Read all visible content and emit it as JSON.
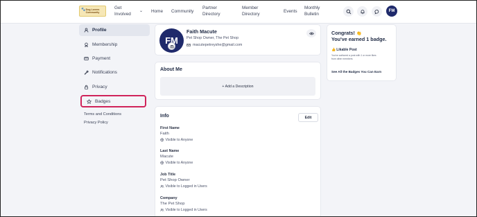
{
  "logo": {
    "line1": "Dog Lovers",
    "line2": "Community"
  },
  "nav": {
    "items": [
      {
        "label": "Get Involved",
        "line1": "Get",
        "line2": "Involved"
      },
      {
        "label": "Home"
      },
      {
        "label": "Community"
      },
      {
        "label": "Partner Directory",
        "line1": "Partner",
        "line2": "Directory"
      },
      {
        "label": "Member Directory",
        "line1": "Member",
        "line2": "Directory"
      },
      {
        "label": "Events"
      },
      {
        "label": "Monthly Bulletin",
        "line1": "Monthly",
        "line2": "Bulletin"
      }
    ],
    "icons": [
      "search-icon",
      "bell-icon",
      "chat-icon"
    ],
    "avatar_initials": "FM"
  },
  "sidebar": {
    "items": [
      {
        "label": "Profile",
        "icon": "user-icon",
        "active": true
      },
      {
        "label": "Membership",
        "icon": "badge-icon"
      },
      {
        "label": "Payment",
        "icon": "card-icon"
      },
      {
        "label": "Notifications",
        "icon": "wrench-icon"
      },
      {
        "label": "Privacy",
        "icon": "lock-icon"
      },
      {
        "label": "Badges",
        "icon": "star-icon",
        "highlighted": true
      }
    ],
    "links": [
      "Terms and Conditions",
      "Privacy Policy"
    ]
  },
  "profile": {
    "initials": "FM",
    "name": "Faith Macute",
    "subtitle": "Pet Shop Owner, The Pet Shop",
    "email": "macutepetreyshe@gmail.com"
  },
  "about": {
    "title": "About Me",
    "add_label": "+ Add a Description"
  },
  "info": {
    "title": "Info",
    "edit_label": "Edit",
    "fields": [
      {
        "label": "First Name",
        "value": "Faith",
        "visibility": "Visible to Anyone"
      },
      {
        "label": "Last Name",
        "value": "Macute",
        "visibility": "Visible to Anyone"
      },
      {
        "label": "Job Title",
        "value": "Pet Shop Owner",
        "visibility": "Visible to Logged in Users"
      },
      {
        "label": "Company",
        "value": "The Pet Shop",
        "visibility": "Visible to Logged in Users"
      }
    ]
  },
  "badges_card": {
    "line1": "Congrats!",
    "emoji": "👏",
    "line2": "You've earned 1 badge.",
    "badge_name": "Likable Post",
    "badge_desc_1": "You've authored a post with 1 or more likes",
    "badge_desc_2": "from other members",
    "see_all": "See All the Badges You Can Earn"
  },
  "colors": {
    "accent_navy": "#1f2a6b",
    "highlight": "#d0235a",
    "page_bg": "#f3f4f8"
  }
}
